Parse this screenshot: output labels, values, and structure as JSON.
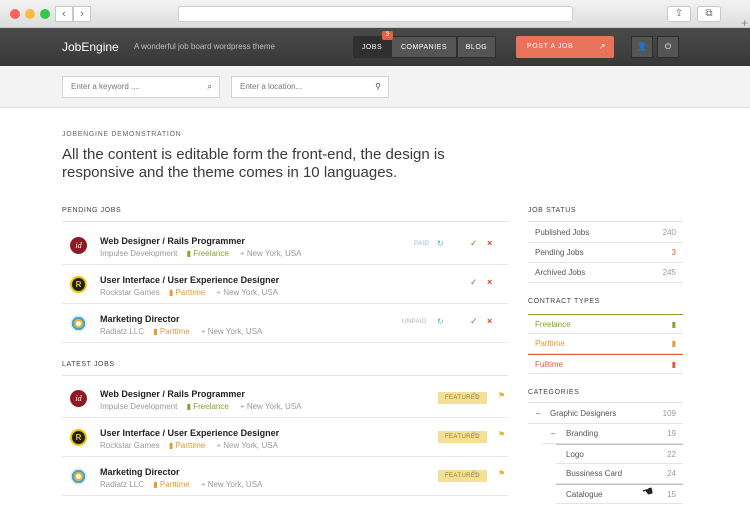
{
  "browser": {
    "back": "‹",
    "forward": "›",
    "share_icon": "share-icon",
    "tabs_icon": "tabs-icon",
    "new_tab": "+"
  },
  "header": {
    "logo": "JobEngine",
    "tagline": "A wonderful job board wordpress theme",
    "nav": {
      "jobs": "JOBS",
      "companies": "COMPANIES",
      "blog": "BLOG",
      "jobs_badge": "3"
    },
    "post_job": "POST A JOB",
    "account_icon": "user-icon",
    "power_icon": "power-icon"
  },
  "search": {
    "keyword_placeholder": "Enter a keyword ....",
    "location_placeholder": "Enter a location..."
  },
  "intro": {
    "eyebrow": "JOBENGINE DEMONSTRATION",
    "headline": "All the content is editable form the front-end, the design is responsive and the theme comes in 10 languages."
  },
  "pending_jobs": {
    "title": "PENDING JOBS",
    "rows": [
      {
        "title": "Web Designer / Rails Programmer",
        "company": "Impulse Development",
        "type": "Freelance",
        "location": "New York, USA",
        "status": "PAID",
        "logo": "ID"
      },
      {
        "title": "User Interface / User Experience Designer",
        "company": "Rockstar Games",
        "type": "Parttime",
        "location": "New York, USA",
        "status": "",
        "logo": "R"
      },
      {
        "title": "Marketing Director",
        "company": "Radiatz LLC",
        "type": "Parttime",
        "location": "New York, USA",
        "status": "UNPAID",
        "logo": ""
      }
    ]
  },
  "latest_jobs": {
    "title": "LATEST JOBS",
    "featured_label": "FEATURED",
    "rows": [
      {
        "title": "Web Designer / Rails Programmer",
        "company": "Impulse Development",
        "type": "Freelance",
        "location": "New York, USA",
        "logo": "ID"
      },
      {
        "title": "User Interface / User Experience Designer",
        "company": "Rockstar Games",
        "type": "Parttime",
        "location": "New York, USA",
        "logo": "R"
      },
      {
        "title": "Marketing Director",
        "company": "Radiatz LLC",
        "type": "Parttime",
        "location": "New York, USA",
        "logo": ""
      }
    ]
  },
  "job_status": {
    "title": "JOB STATUS",
    "items": [
      {
        "label": "Published Jobs",
        "count": "240"
      },
      {
        "label": "Pending Jobs",
        "count": "3"
      },
      {
        "label": "Archived Jobs",
        "count": "245"
      }
    ]
  },
  "contract_types": {
    "title": "CONTRACT TYPES",
    "items": [
      {
        "label": "Freelance",
        "color": "#7fa62c"
      },
      {
        "label": "Parttime",
        "color": "#e69a2f"
      },
      {
        "label": "Fulltime",
        "color": "#e5593f"
      }
    ]
  },
  "categories": {
    "title": "CATEGORIES",
    "items": [
      {
        "label": "Graphic Designers",
        "count": "109",
        "prefix": "–"
      },
      {
        "label": "Branding",
        "count": "19",
        "prefix": "–"
      },
      {
        "label": "Logo",
        "count": "22",
        "prefix": ""
      },
      {
        "label": "Bussiness Card",
        "count": "24",
        "prefix": ""
      },
      {
        "label": "Catalogue",
        "count": "15",
        "prefix": ""
      }
    ]
  },
  "colors": {
    "header": "#3f3f3f",
    "accent": "#e8735a",
    "freelance": "#7fa62c",
    "parttime": "#e69a2f",
    "fulltime": "#e5593f"
  }
}
